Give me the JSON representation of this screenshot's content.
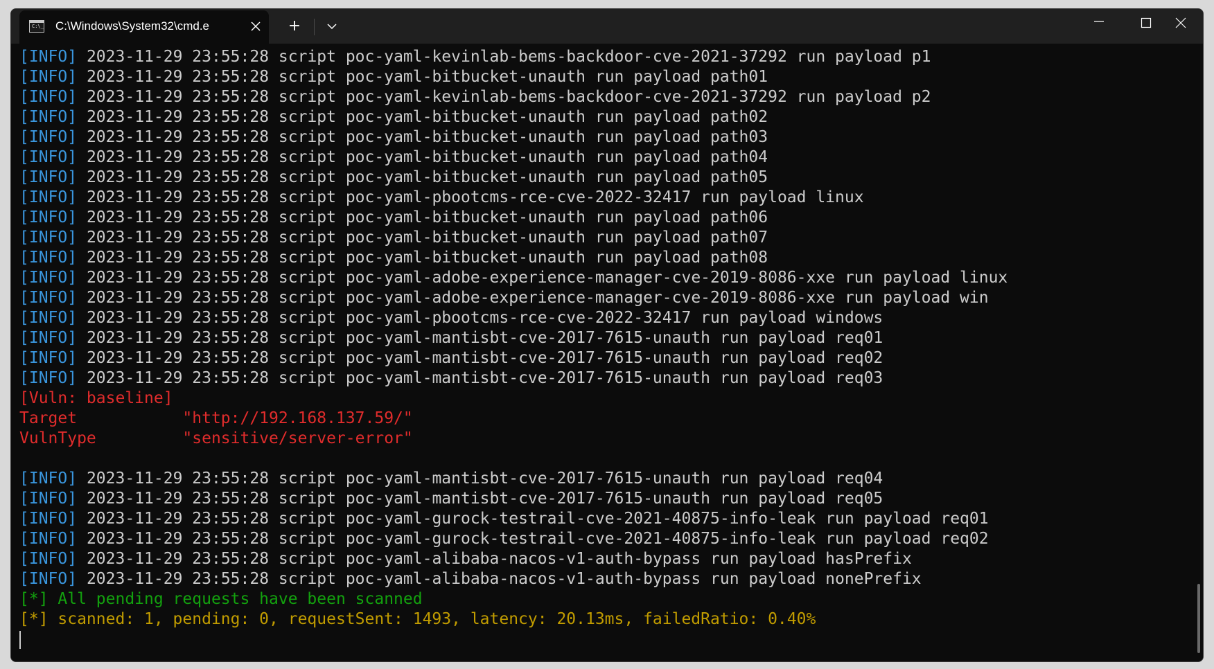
{
  "window": {
    "tab_title": "C:\\Windows\\System32\\cmd.e",
    "tab_icon_text": "C:\\_",
    "new_tab_label": "+"
  },
  "console": {
    "info_tag": "[INFO]",
    "info_lines": [
      "2023-11-29 23:55:28 script poc-yaml-kevinlab-bems-backdoor-cve-2021-37292 run payload p1",
      "2023-11-29 23:55:28 script poc-yaml-bitbucket-unauth run payload path01",
      "2023-11-29 23:55:28 script poc-yaml-kevinlab-bems-backdoor-cve-2021-37292 run payload p2",
      "2023-11-29 23:55:28 script poc-yaml-bitbucket-unauth run payload path02",
      "2023-11-29 23:55:28 script poc-yaml-bitbucket-unauth run payload path03",
      "2023-11-29 23:55:28 script poc-yaml-bitbucket-unauth run payload path04",
      "2023-11-29 23:55:28 script poc-yaml-bitbucket-unauth run payload path05",
      "2023-11-29 23:55:28 script poc-yaml-pbootcms-rce-cve-2022-32417 run payload linux",
      "2023-11-29 23:55:28 script poc-yaml-bitbucket-unauth run payload path06",
      "2023-11-29 23:55:28 script poc-yaml-bitbucket-unauth run payload path07",
      "2023-11-29 23:55:28 script poc-yaml-bitbucket-unauth run payload path08",
      "2023-11-29 23:55:28 script poc-yaml-adobe-experience-manager-cve-2019-8086-xxe run payload linux",
      "2023-11-29 23:55:28 script poc-yaml-adobe-experience-manager-cve-2019-8086-xxe run payload win",
      "2023-11-29 23:55:28 script poc-yaml-pbootcms-rce-cve-2022-32417 run payload windows",
      "2023-11-29 23:55:28 script poc-yaml-mantisbt-cve-2017-7615-unauth run payload req01",
      "2023-11-29 23:55:28 script poc-yaml-mantisbt-cve-2017-7615-unauth run payload req02",
      "2023-11-29 23:55:28 script poc-yaml-mantisbt-cve-2017-7615-unauth run payload req03"
    ],
    "vuln": {
      "header": "[Vuln: baseline]",
      "target_label": "Target",
      "target_value": "\"http://192.168.137.59/\"",
      "type_label": "VulnType",
      "type_value": "\"sensitive/server-error\""
    },
    "info_lines_after": [
      "2023-11-29 23:55:28 script poc-yaml-mantisbt-cve-2017-7615-unauth run payload req04",
      "2023-11-29 23:55:28 script poc-yaml-mantisbt-cve-2017-7615-unauth run payload req05",
      "2023-11-29 23:55:28 script poc-yaml-gurock-testrail-cve-2021-40875-info-leak run payload req01",
      "2023-11-29 23:55:28 script poc-yaml-gurock-testrail-cve-2021-40875-info-leak run payload req02",
      "2023-11-29 23:55:28 script poc-yaml-alibaba-nacos-v1-auth-bypass run payload hasPrefix",
      "2023-11-29 23:55:28 script poc-yaml-alibaba-nacos-v1-auth-bypass run payload nonePrefix"
    ],
    "done_line": "[*] All pending requests have been scanned",
    "stats_line": "[*] scanned: 1, pending: 0, requestSent: 1493, latency: 20.13ms, failedRatio: 0.40%"
  },
  "colors": {
    "background": "#0c0c0c",
    "info_tag": "#3a96dd",
    "vuln": "#e12c2c",
    "done": "#13a10e",
    "stats": "#c19c00",
    "text": "#cccccc"
  },
  "icons": [
    "cmd-icon",
    "close-icon",
    "plus-icon",
    "chevron-down-icon",
    "minimize-icon",
    "maximize-icon",
    "window-close-icon"
  ]
}
